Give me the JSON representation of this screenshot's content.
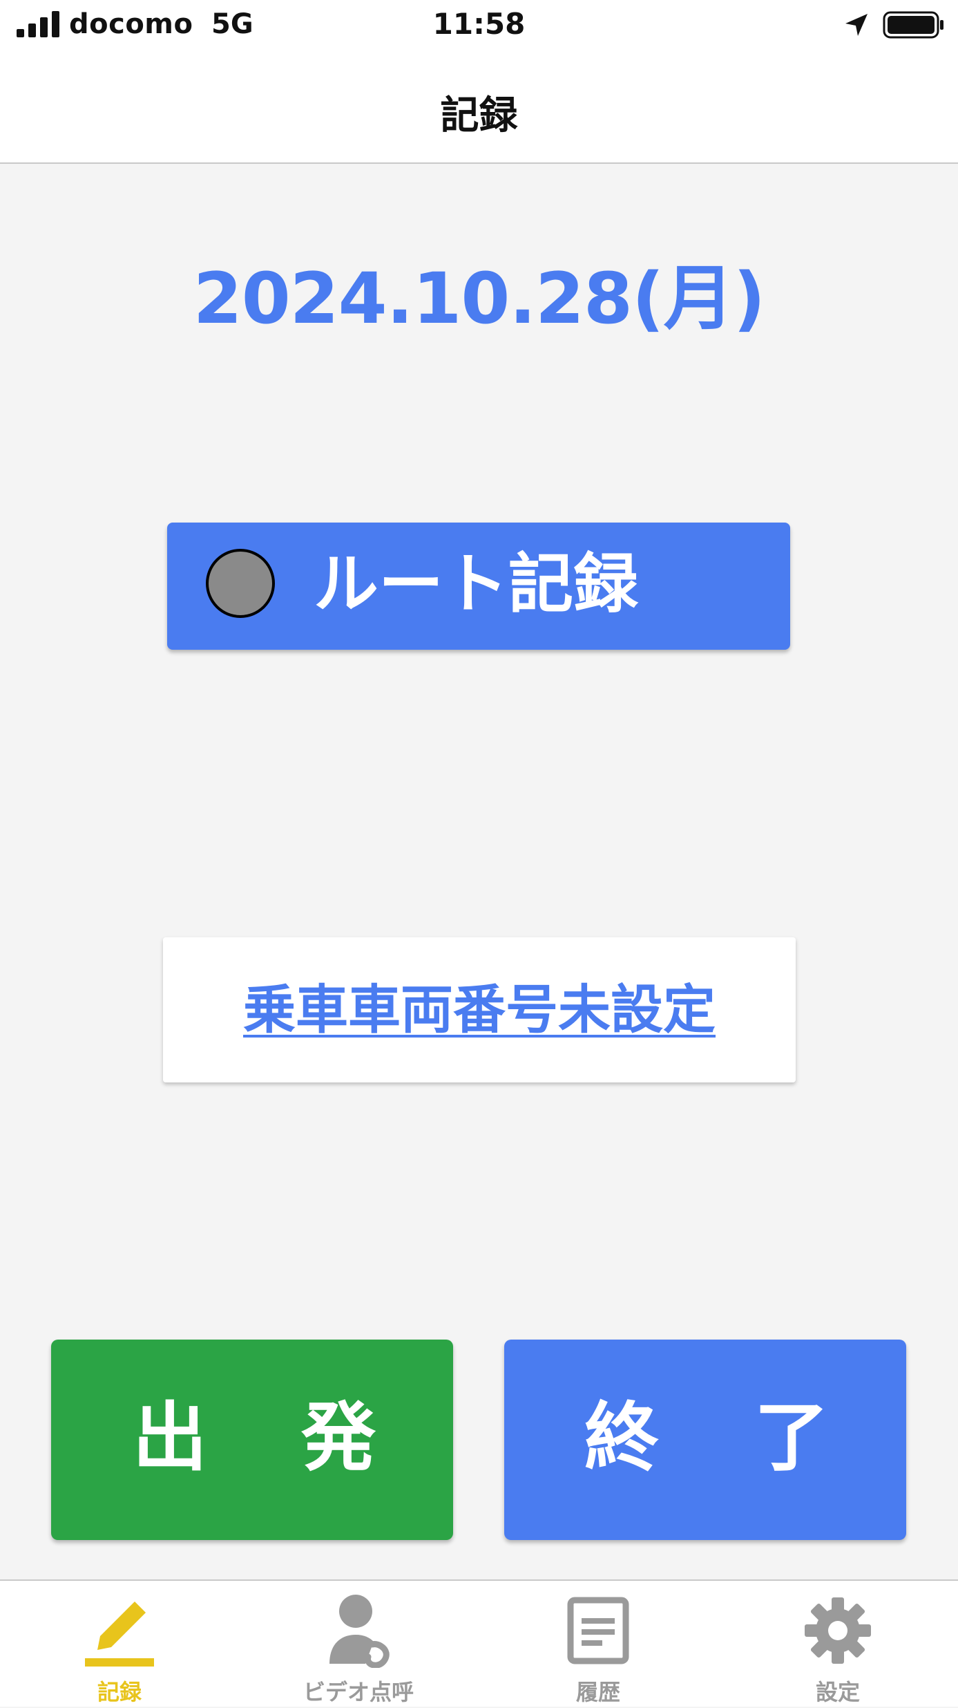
{
  "status_bar": {
    "carrier": "docomo",
    "network": "5G",
    "time": "11:58"
  },
  "header": {
    "title": "記録"
  },
  "main": {
    "date": "2024.10.28(月)",
    "route_button_label": "ルート記録",
    "vehicle_link": "乗車車両番号未設定"
  },
  "actions": {
    "depart": [
      "出",
      "発"
    ],
    "finish": [
      "終",
      "了"
    ]
  },
  "tabs": [
    {
      "label": "記録",
      "icon": "pencil-icon",
      "active": true
    },
    {
      "label": "ビデオ点呼",
      "icon": "person-phone-icon",
      "active": false
    },
    {
      "label": "履歴",
      "icon": "document-icon",
      "active": false
    },
    {
      "label": "設定",
      "icon": "gear-icon",
      "active": false
    }
  ],
  "colors": {
    "accent_blue": "#4a7cf0",
    "depart_green": "#2ba445",
    "active_tab": "#e8c41c",
    "inactive_tab": "#9a9a9a"
  }
}
